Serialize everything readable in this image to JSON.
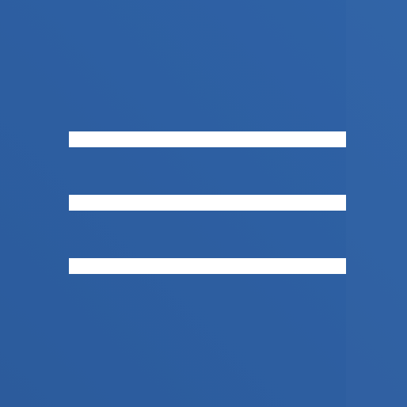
{
  "icon": {
    "name": "hamburger-menu-icon",
    "background_color": "#2d5fa2",
    "bar_color": "#ffffff",
    "bar_count": 3
  }
}
